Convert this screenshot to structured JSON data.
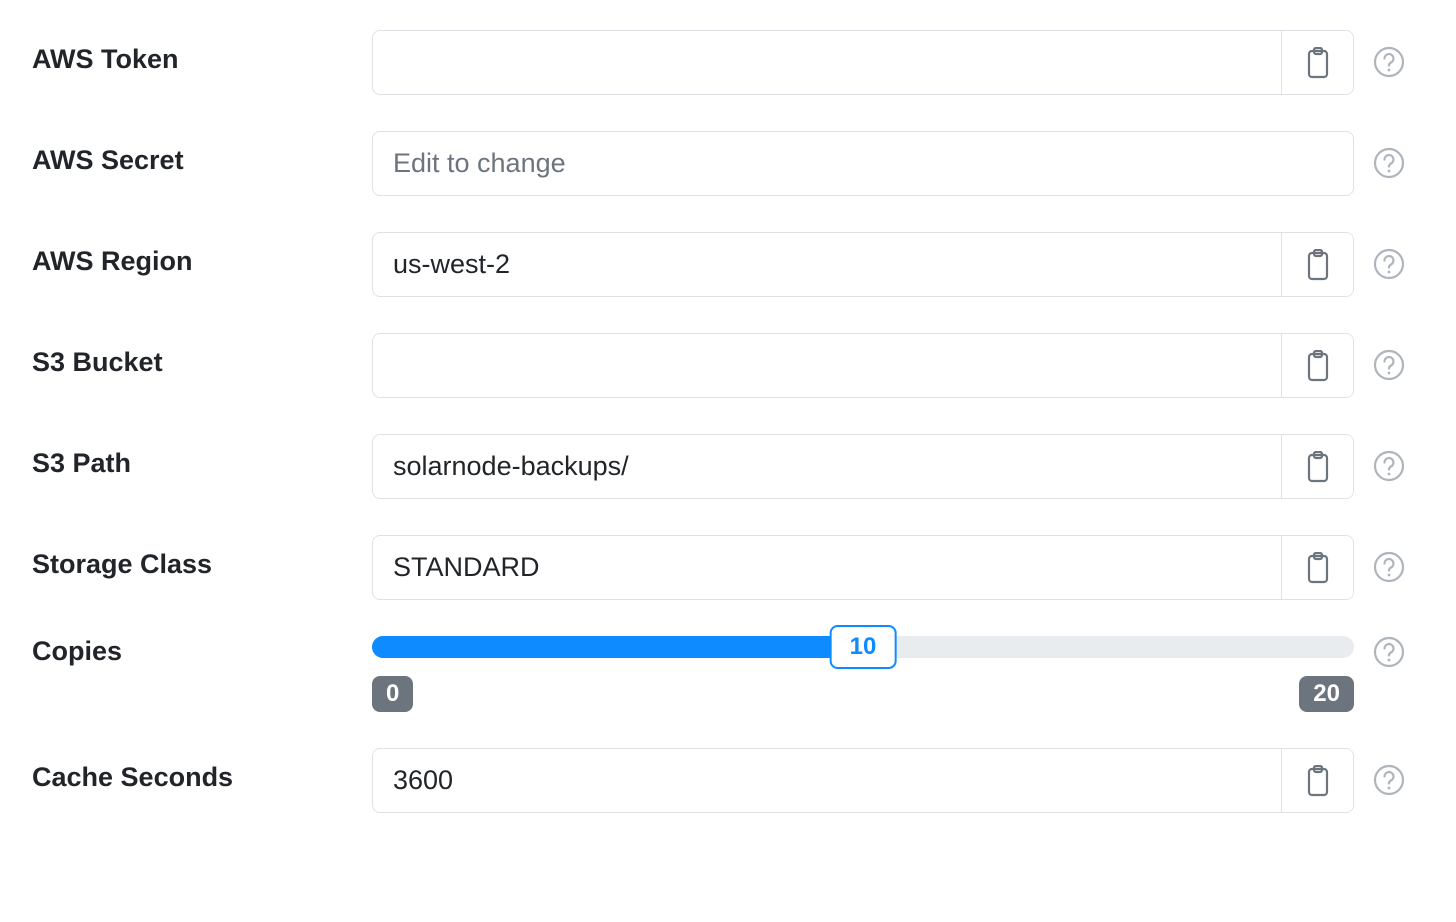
{
  "fields": {
    "aws_token": {
      "label": "AWS Token",
      "value": "",
      "placeholder": ""
    },
    "aws_secret": {
      "label": "AWS Secret",
      "value": "",
      "placeholder": "Edit to change"
    },
    "aws_region": {
      "label": "AWS Region",
      "value": "us-west-2",
      "placeholder": ""
    },
    "s3_bucket": {
      "label": "S3 Bucket",
      "value": "",
      "placeholder": ""
    },
    "s3_path": {
      "label": "S3 Path",
      "value": "solarnode-backups/",
      "placeholder": ""
    },
    "storage_class": {
      "label": "Storage Class",
      "value": "STANDARD",
      "placeholder": ""
    },
    "cache_seconds": {
      "label": "Cache Seconds",
      "value": "3600",
      "placeholder": ""
    }
  },
  "copies": {
    "label": "Copies",
    "min": 0,
    "max": 20,
    "value": 10
  }
}
